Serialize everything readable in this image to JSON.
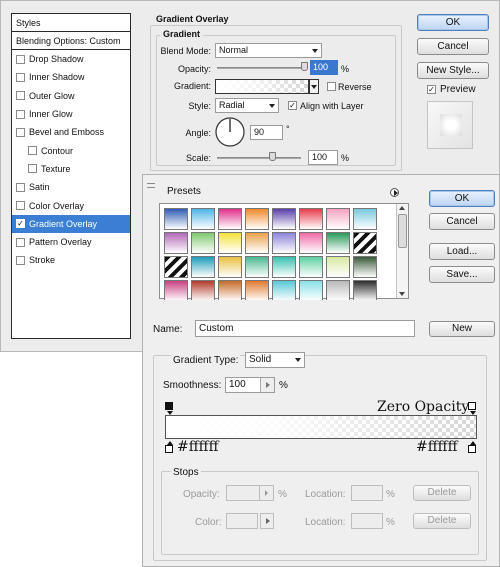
{
  "layer_style": {
    "styles_header": "Styles",
    "blending_options": "Blending Options: Custom",
    "effects": [
      {
        "label": "Drop Shadow",
        "checked": false,
        "sub": false,
        "selected": false
      },
      {
        "label": "Inner Shadow",
        "checked": false,
        "sub": false,
        "selected": false
      },
      {
        "label": "Outer Glow",
        "checked": false,
        "sub": false,
        "selected": false
      },
      {
        "label": "Inner Glow",
        "checked": false,
        "sub": false,
        "selected": false
      },
      {
        "label": "Bevel and Emboss",
        "checked": false,
        "sub": false,
        "selected": false
      },
      {
        "label": "Contour",
        "checked": false,
        "sub": true,
        "selected": false
      },
      {
        "label": "Texture",
        "checked": false,
        "sub": true,
        "selected": false
      },
      {
        "label": "Satin",
        "checked": false,
        "sub": false,
        "selected": false
      },
      {
        "label": "Color Overlay",
        "checked": false,
        "sub": false,
        "selected": false
      },
      {
        "label": "Gradient Overlay",
        "checked": true,
        "sub": false,
        "selected": true
      },
      {
        "label": "Pattern Overlay",
        "checked": false,
        "sub": false,
        "selected": false
      },
      {
        "label": "Stroke",
        "checked": false,
        "sub": false,
        "selected": false
      }
    ],
    "panel_title": "Gradient Overlay",
    "group_title": "Gradient",
    "blend_mode_label": "Blend Mode:",
    "blend_mode_value": "Normal",
    "opacity_label": "Opacity:",
    "opacity_value": "100",
    "opacity_unit": "%",
    "opacity_level": 1.0,
    "gradient_label": "Gradient:",
    "reverse_label": "Reverse",
    "reverse_checked": false,
    "style_label": "Style:",
    "style_value": "Radial",
    "align_label": "Align with Layer",
    "align_checked": true,
    "angle_label": "Angle:",
    "angle_value": "90",
    "angle_unit": "°",
    "scale_label": "Scale:",
    "scale_value": "100",
    "scale_unit": "%",
    "scale_level": 0.65,
    "ok_label": "OK",
    "cancel_label": "Cancel",
    "new_style_label": "New Style...",
    "preview_label": "Preview",
    "preview_checked": true
  },
  "gradient_editor": {
    "presets_label": "Presets",
    "ok_label": "OK",
    "cancel_label": "Cancel",
    "load_label": "Load...",
    "save_label": "Save...",
    "name_label": "Name:",
    "name_value": "Custom",
    "new_label": "New",
    "gradient_type_label": "Gradient Type:",
    "gradient_type_value": "Solid",
    "smoothness_label": "Smoothness:",
    "smoothness_value": "100",
    "smoothness_unit": "%",
    "annotation_top": "Zero Opacity",
    "annotation_left": "#ffffff",
    "annotation_right": "#ffffff",
    "stops_title": "Stops",
    "stop_opacity_label": "Opacity:",
    "stop_opacity_unit": "%",
    "stop_location_label": "Location:",
    "stop_location_unit": "%",
    "stop_color_label": "Color:",
    "delete_label": "Delete",
    "presets": [
      [
        "#2f5db3",
        "#4fb4e6",
        "#e0308a",
        "#f08a2a",
        "#5a3fa8",
        "#e83c4a",
        "#f4a3c0",
        "#78c8dc"
      ],
      [
        "#b06ab8",
        "#7fc86e",
        "#f2e23a",
        "#e8a14a",
        "#8b84d8",
        "#f06aa8",
        "#2a9a5a",
        "#4a4a4a"
      ],
      [
        "#222222",
        "#1f9bb8",
        "#e8c040",
        "#4ab890",
        "#38c0b0",
        "#5fd0a0",
        "#d8e8a0",
        "#3a5a3a"
      ],
      [
        "#c84080",
        "#b03a2a",
        "#c86a2a",
        "#e07a30",
        "#58c8d8",
        "#88e0e8",
        "#b8b8b8",
        "#2e2e2e"
      ]
    ]
  }
}
